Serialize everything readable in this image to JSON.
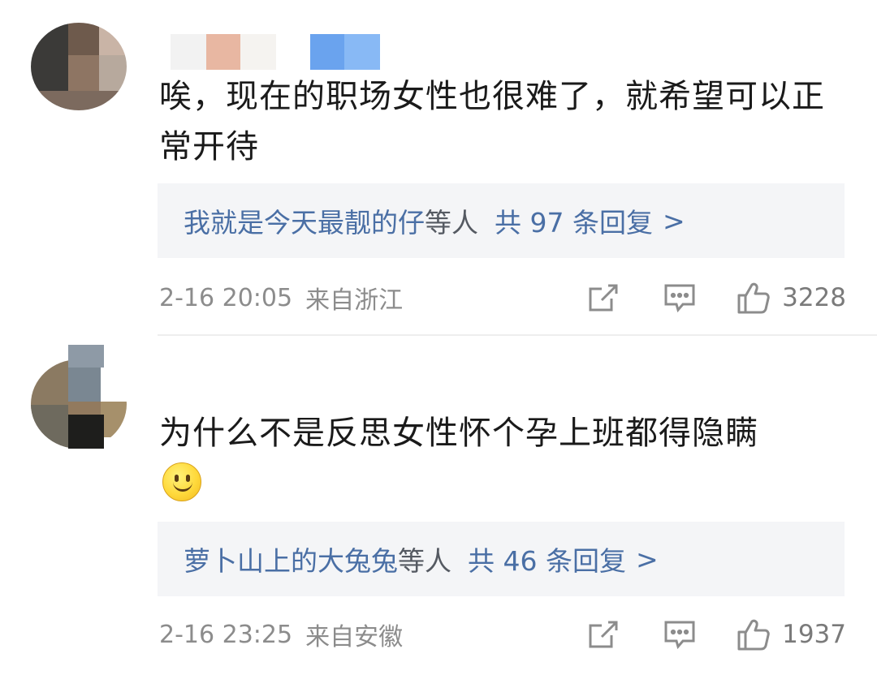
{
  "comments": [
    {
      "text": "唉，现在的职场女性也很难了，就希望可以正常开待",
      "reply_users": "我就是今天最靓的仔",
      "reply_suffix": "等人",
      "reply_count": "共 97 条回复",
      "reply_arrow": ">",
      "date": "2-16 20:05",
      "location": "来自浙江",
      "likes": "3228"
    },
    {
      "text": "为什么不是反思女性怀个孕上班都得隐瞒",
      "emoji": "smile-emoji",
      "reply_users": "萝卜山上的大兔兔",
      "reply_suffix": "等人",
      "reply_count": "共 46 条回复",
      "reply_arrow": ">",
      "date": "2-16 23:25",
      "location": "来自安徽",
      "likes": "1937"
    }
  ],
  "icons": {
    "share": "share-icon",
    "comment": "comment-icon",
    "like": "thumbs-up-icon"
  },
  "colors": {
    "link": "#4a6fa5",
    "meta": "#8c8c8c",
    "reply_bg": "#f4f5f7"
  }
}
